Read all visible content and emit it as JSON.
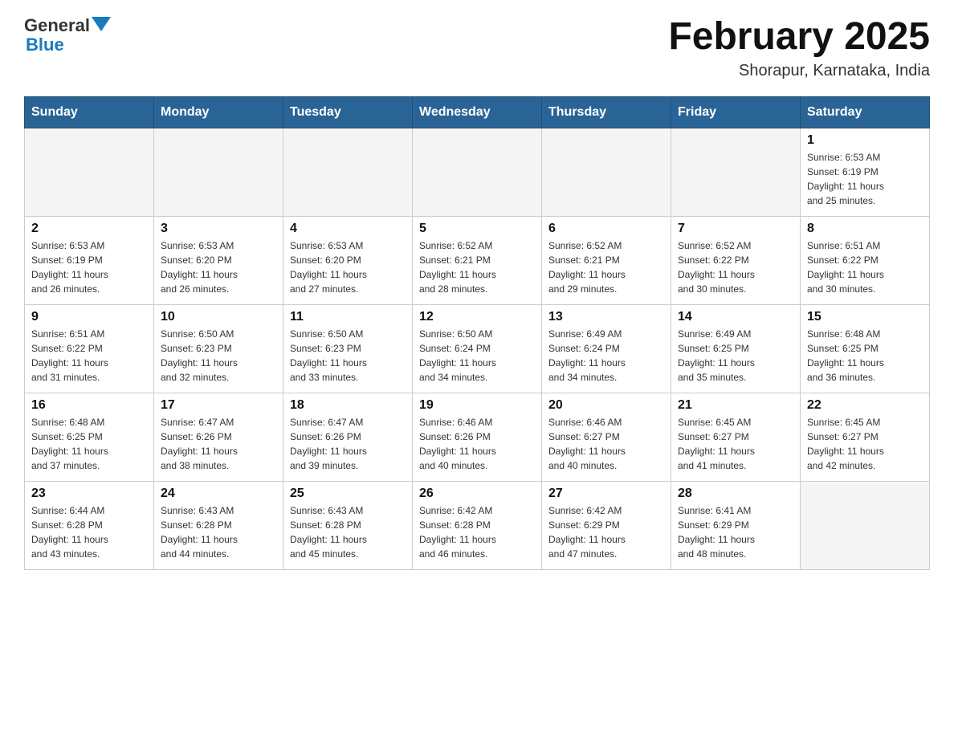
{
  "header": {
    "logo_line1": "General",
    "logo_line2": "Blue",
    "title": "February 2025",
    "subtitle": "Shorapur, Karnataka, India"
  },
  "days_of_week": [
    "Sunday",
    "Monday",
    "Tuesday",
    "Wednesday",
    "Thursday",
    "Friday",
    "Saturday"
  ],
  "weeks": [
    {
      "days": [
        {
          "number": "",
          "info": "",
          "empty": true
        },
        {
          "number": "",
          "info": "",
          "empty": true
        },
        {
          "number": "",
          "info": "",
          "empty": true
        },
        {
          "number": "",
          "info": "",
          "empty": true
        },
        {
          "number": "",
          "info": "",
          "empty": true
        },
        {
          "number": "",
          "info": "",
          "empty": true
        },
        {
          "number": "1",
          "info": "Sunrise: 6:53 AM\nSunset: 6:19 PM\nDaylight: 11 hours\nand 25 minutes.",
          "empty": false
        }
      ]
    },
    {
      "days": [
        {
          "number": "2",
          "info": "Sunrise: 6:53 AM\nSunset: 6:19 PM\nDaylight: 11 hours\nand 26 minutes.",
          "empty": false
        },
        {
          "number": "3",
          "info": "Sunrise: 6:53 AM\nSunset: 6:20 PM\nDaylight: 11 hours\nand 26 minutes.",
          "empty": false
        },
        {
          "number": "4",
          "info": "Sunrise: 6:53 AM\nSunset: 6:20 PM\nDaylight: 11 hours\nand 27 minutes.",
          "empty": false
        },
        {
          "number": "5",
          "info": "Sunrise: 6:52 AM\nSunset: 6:21 PM\nDaylight: 11 hours\nand 28 minutes.",
          "empty": false
        },
        {
          "number": "6",
          "info": "Sunrise: 6:52 AM\nSunset: 6:21 PM\nDaylight: 11 hours\nand 29 minutes.",
          "empty": false
        },
        {
          "number": "7",
          "info": "Sunrise: 6:52 AM\nSunset: 6:22 PM\nDaylight: 11 hours\nand 30 minutes.",
          "empty": false
        },
        {
          "number": "8",
          "info": "Sunrise: 6:51 AM\nSunset: 6:22 PM\nDaylight: 11 hours\nand 30 minutes.",
          "empty": false
        }
      ]
    },
    {
      "days": [
        {
          "number": "9",
          "info": "Sunrise: 6:51 AM\nSunset: 6:22 PM\nDaylight: 11 hours\nand 31 minutes.",
          "empty": false
        },
        {
          "number": "10",
          "info": "Sunrise: 6:50 AM\nSunset: 6:23 PM\nDaylight: 11 hours\nand 32 minutes.",
          "empty": false
        },
        {
          "number": "11",
          "info": "Sunrise: 6:50 AM\nSunset: 6:23 PM\nDaylight: 11 hours\nand 33 minutes.",
          "empty": false
        },
        {
          "number": "12",
          "info": "Sunrise: 6:50 AM\nSunset: 6:24 PM\nDaylight: 11 hours\nand 34 minutes.",
          "empty": false
        },
        {
          "number": "13",
          "info": "Sunrise: 6:49 AM\nSunset: 6:24 PM\nDaylight: 11 hours\nand 34 minutes.",
          "empty": false
        },
        {
          "number": "14",
          "info": "Sunrise: 6:49 AM\nSunset: 6:25 PM\nDaylight: 11 hours\nand 35 minutes.",
          "empty": false
        },
        {
          "number": "15",
          "info": "Sunrise: 6:48 AM\nSunset: 6:25 PM\nDaylight: 11 hours\nand 36 minutes.",
          "empty": false
        }
      ]
    },
    {
      "days": [
        {
          "number": "16",
          "info": "Sunrise: 6:48 AM\nSunset: 6:25 PM\nDaylight: 11 hours\nand 37 minutes.",
          "empty": false
        },
        {
          "number": "17",
          "info": "Sunrise: 6:47 AM\nSunset: 6:26 PM\nDaylight: 11 hours\nand 38 minutes.",
          "empty": false
        },
        {
          "number": "18",
          "info": "Sunrise: 6:47 AM\nSunset: 6:26 PM\nDaylight: 11 hours\nand 39 minutes.",
          "empty": false
        },
        {
          "number": "19",
          "info": "Sunrise: 6:46 AM\nSunset: 6:26 PM\nDaylight: 11 hours\nand 40 minutes.",
          "empty": false
        },
        {
          "number": "20",
          "info": "Sunrise: 6:46 AM\nSunset: 6:27 PM\nDaylight: 11 hours\nand 40 minutes.",
          "empty": false
        },
        {
          "number": "21",
          "info": "Sunrise: 6:45 AM\nSunset: 6:27 PM\nDaylight: 11 hours\nand 41 minutes.",
          "empty": false
        },
        {
          "number": "22",
          "info": "Sunrise: 6:45 AM\nSunset: 6:27 PM\nDaylight: 11 hours\nand 42 minutes.",
          "empty": false
        }
      ]
    },
    {
      "days": [
        {
          "number": "23",
          "info": "Sunrise: 6:44 AM\nSunset: 6:28 PM\nDaylight: 11 hours\nand 43 minutes.",
          "empty": false
        },
        {
          "number": "24",
          "info": "Sunrise: 6:43 AM\nSunset: 6:28 PM\nDaylight: 11 hours\nand 44 minutes.",
          "empty": false
        },
        {
          "number": "25",
          "info": "Sunrise: 6:43 AM\nSunset: 6:28 PM\nDaylight: 11 hours\nand 45 minutes.",
          "empty": false
        },
        {
          "number": "26",
          "info": "Sunrise: 6:42 AM\nSunset: 6:28 PM\nDaylight: 11 hours\nand 46 minutes.",
          "empty": false
        },
        {
          "number": "27",
          "info": "Sunrise: 6:42 AM\nSunset: 6:29 PM\nDaylight: 11 hours\nand 47 minutes.",
          "empty": false
        },
        {
          "number": "28",
          "info": "Sunrise: 6:41 AM\nSunset: 6:29 PM\nDaylight: 11 hours\nand 48 minutes.",
          "empty": false
        },
        {
          "number": "",
          "info": "",
          "empty": true
        }
      ]
    }
  ]
}
